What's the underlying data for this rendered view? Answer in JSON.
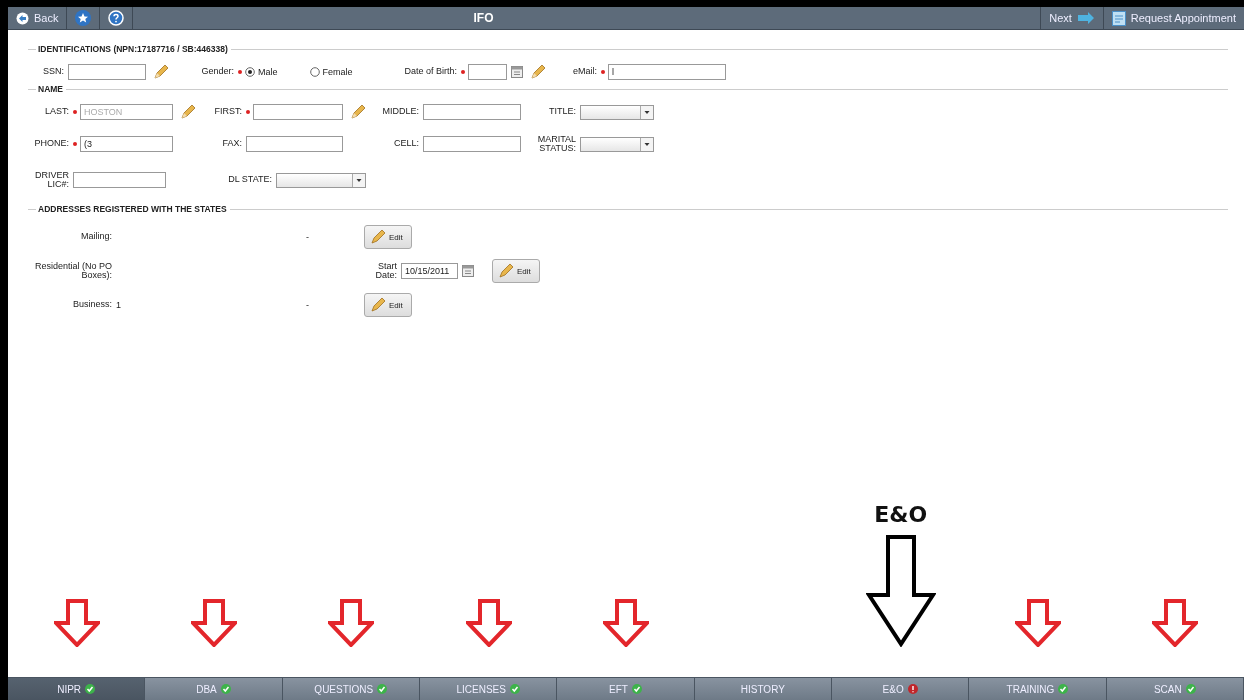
{
  "header": {
    "back": "Back",
    "title": "IFO",
    "next": "Next",
    "request": "Request Appointment"
  },
  "sections": [
    {
      "kind": "identifications",
      "title": "IDENTIFICATIONS (NPN:17187716 / SB:446338)",
      "fields": [
        {
          "kind": "text",
          "label": "SSN:",
          "required": false,
          "editable": true
        },
        {
          "kind": "radio",
          "label": "Gender:",
          "required": true,
          "editable": false,
          "options": [
            {
              "label": "Male",
              "selected": true
            },
            {
              "label": "Female",
              "selected": false
            }
          ]
        },
        {
          "kind": "date",
          "label": "Date of Birth:",
          "required": true,
          "editable": true
        },
        {
          "kind": "text",
          "label": "eMail:",
          "required": true,
          "value": "l",
          "editable": false
        }
      ]
    },
    {
      "kind": "name",
      "title": "NAME",
      "rows": [
        [
          {
            "kind": "text",
            "label": "LAST:",
            "required": true,
            "placeholder": "HOSTON",
            "editable": true
          },
          {
            "kind": "text",
            "label": "FIRST:",
            "required": true,
            "editable": true
          },
          {
            "kind": "text",
            "label": "MIDDLE:",
            "required": false,
            "editable": false
          },
          {
            "kind": "select",
            "label": "TITLE:",
            "required": false,
            "editable": false
          }
        ],
        [
          {
            "kind": "text",
            "label": "PHONE:",
            "required": true,
            "value": "(3",
            "editable": false
          },
          {
            "kind": "text",
            "label": "FAX:",
            "required": false,
            "editable": false
          },
          {
            "kind": "text",
            "label": "CELL:",
            "required": false,
            "editable": false
          },
          {
            "kind": "select",
            "label": "MARITAL STATUS:",
            "required": false,
            "editable": false
          }
        ],
        [
          {
            "kind": "text",
            "label": "DRIVER LIC#:",
            "required": false,
            "editable": false
          },
          {
            "kind": "select",
            "label": "DL STATE:",
            "required": false,
            "editable": false
          }
        ]
      ]
    },
    {
      "kind": "addresses",
      "title": "ADDRESSES REGISTERED WITH THE STATES",
      "rows": [
        {
          "label": "Mailing:",
          "separator": "-",
          "button": "Edit"
        },
        {
          "label": "Residential (No PO Boxes):",
          "start_label": "Start Date:",
          "start_value": "10/15/2011",
          "button": "Edit"
        },
        {
          "label": "Business:",
          "value": "1",
          "separator": "-",
          "button": "Edit"
        }
      ]
    }
  ],
  "tabs": [
    {
      "label": "NIPR",
      "selected": true,
      "badge": {
        "kind": "check",
        "color": "#3db34a"
      },
      "arrow": {
        "kind": "small",
        "color": "#e3262b"
      }
    },
    {
      "label": "DBA",
      "selected": false,
      "badge": {
        "kind": "check",
        "color": "#3db34a"
      },
      "arrow": {
        "kind": "small",
        "color": "#e3262b"
      }
    },
    {
      "label": "QUESTIONS",
      "selected": false,
      "badge": {
        "kind": "check",
        "color": "#3db34a"
      },
      "arrow": {
        "kind": "small",
        "color": "#e3262b"
      }
    },
    {
      "label": "LICENSES",
      "selected": false,
      "badge": {
        "kind": "check",
        "color": "#3db34a"
      },
      "arrow": {
        "kind": "small",
        "color": "#e3262b"
      }
    },
    {
      "label": "EFT",
      "selected": false,
      "badge": {
        "kind": "check",
        "color": "#3db34a"
      },
      "arrow": {
        "kind": "small",
        "color": "#e3262b"
      }
    },
    {
      "label": "HISTORY",
      "selected": false
    },
    {
      "label": "E&O",
      "selected": false,
      "badge": {
        "kind": "alert",
        "color": "#c0262b"
      },
      "arrow": {
        "kind": "large",
        "color": "#000000",
        "caption": "E&O"
      }
    },
    {
      "label": "TRAINING",
      "selected": false,
      "badge": {
        "kind": "check",
        "color": "#3db34a"
      },
      "arrow": {
        "kind": "small",
        "color": "#e3262b"
      }
    },
    {
      "label": "SCAN",
      "selected": false,
      "badge": {
        "kind": "check",
        "color": "#3db34a"
      },
      "arrow": {
        "kind": "small",
        "color": "#e3262b"
      }
    }
  ]
}
